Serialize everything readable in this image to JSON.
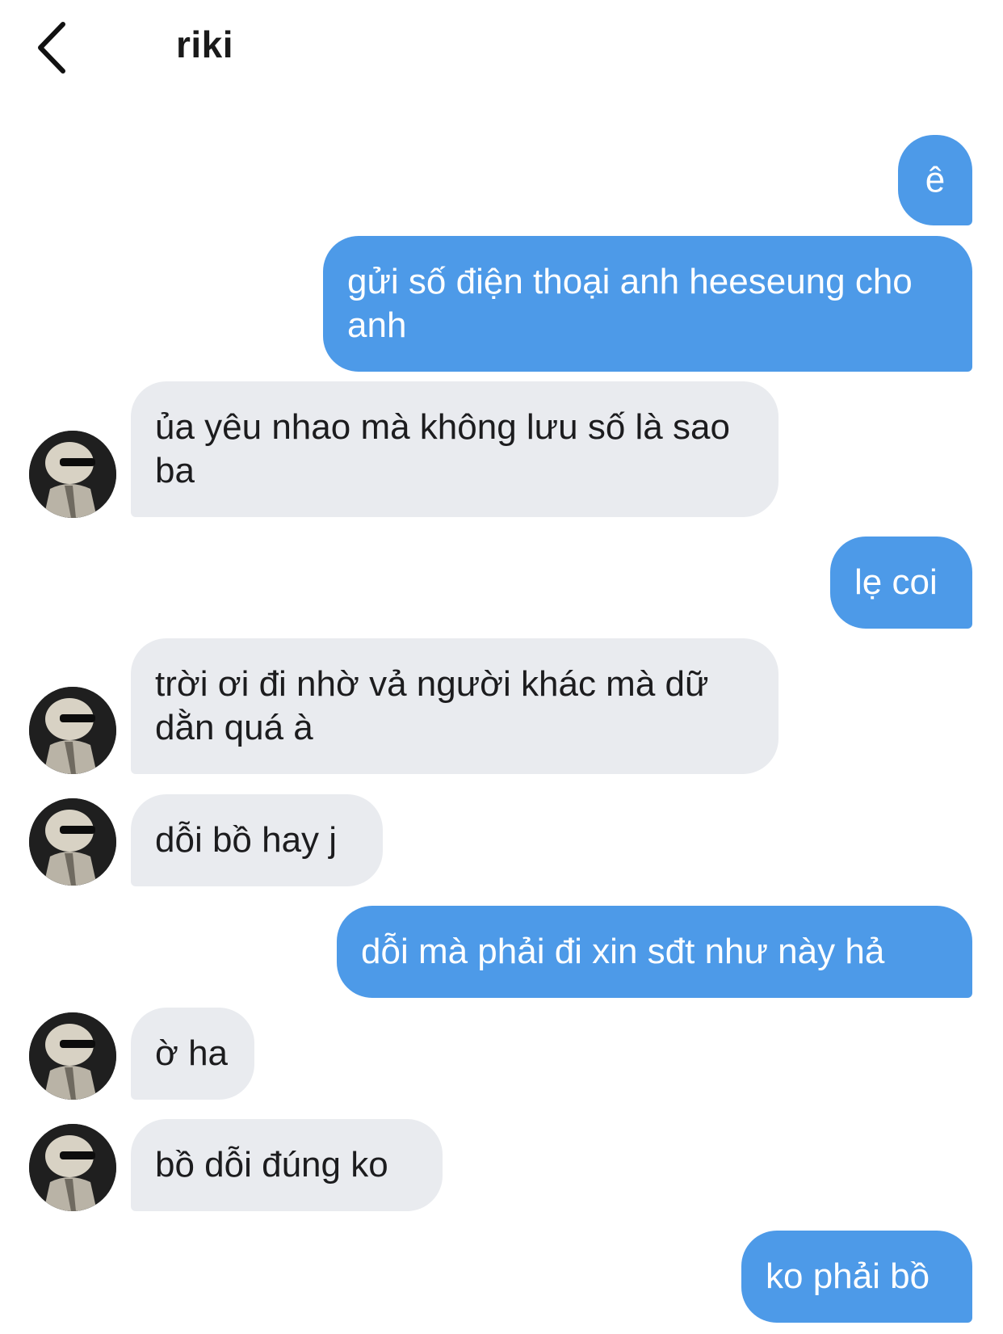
{
  "header": {
    "title": "riki",
    "back_icon": "chevron-left-icon"
  },
  "colors": {
    "sent_bubble": "#4d9ae8",
    "received_bubble": "#e9ebef"
  },
  "messages": [
    {
      "direction": "sent",
      "text": "ê"
    },
    {
      "direction": "sent",
      "text": "gửi số điện thoại anh heeseung cho anh"
    },
    {
      "direction": "received",
      "text": "ủa yêu nhao mà không lưu số là sao ba"
    },
    {
      "direction": "sent",
      "text": "lẹ coi"
    },
    {
      "direction": "received",
      "text": "trời ơi đi nhờ vả người khác mà dữ dằn quá à"
    },
    {
      "direction": "received",
      "text": "dỗi bồ hay j"
    },
    {
      "direction": "sent",
      "text": "dỗi mà phải đi xin sđt như này hả"
    },
    {
      "direction": "received",
      "text": "ờ ha"
    },
    {
      "direction": "received",
      "text": "bồ dỗi đúng ko"
    },
    {
      "direction": "sent",
      "text": "ko phải bồ"
    }
  ]
}
